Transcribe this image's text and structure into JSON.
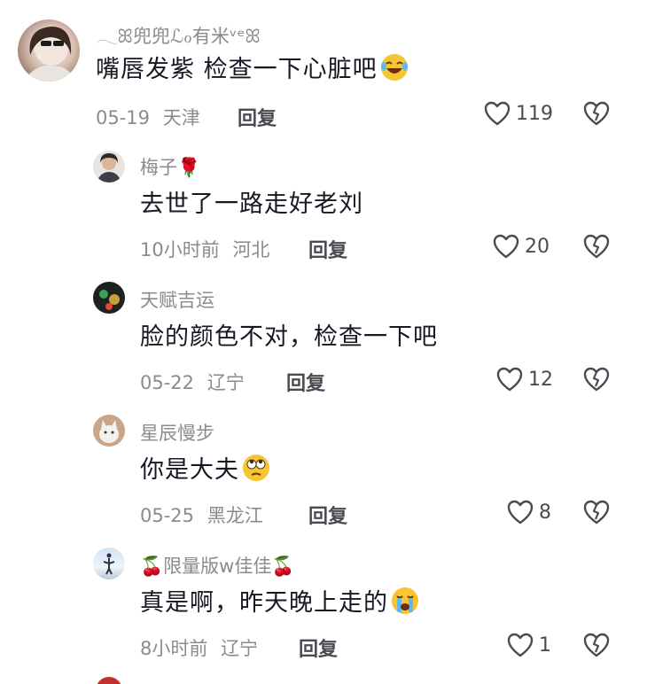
{
  "comments": [
    {
      "username": "𓂃ꕤ兜兜ℒℴ有米ᵛᵉꕤ",
      "text": "嘴唇发紫 检查一下心脏吧",
      "emoji": "laugh-cry",
      "date": "05-19",
      "location": "天津",
      "reply_label": "回复",
      "likes": "119"
    },
    {
      "username": "梅子🌹",
      "text": "去世了一路走好老刘",
      "emoji": "",
      "date": "10小时前",
      "location": "河北",
      "reply_label": "回复",
      "likes": "20"
    },
    {
      "username": "天赋吉运",
      "text": "脸的颜色不对，检查一下吧",
      "emoji": "",
      "date": "05-22",
      "location": "辽宁",
      "reply_label": "回复",
      "likes": "12"
    },
    {
      "username": "星辰慢步",
      "text": "你是大夫",
      "emoji": "eye-roll",
      "date": "05-25",
      "location": "黑龙江",
      "reply_label": "回复",
      "likes": "8"
    },
    {
      "username": "🍒限量版w佳佳🍒",
      "text": "真是啊，昨天晚上走的",
      "emoji": "crying",
      "date": "8小时前",
      "location": "辽宁",
      "reply_label": "回复",
      "likes": "1"
    }
  ],
  "colors": {
    "text": "#161823",
    "secondary": "#8a8b91",
    "action": "#4a4b52"
  }
}
